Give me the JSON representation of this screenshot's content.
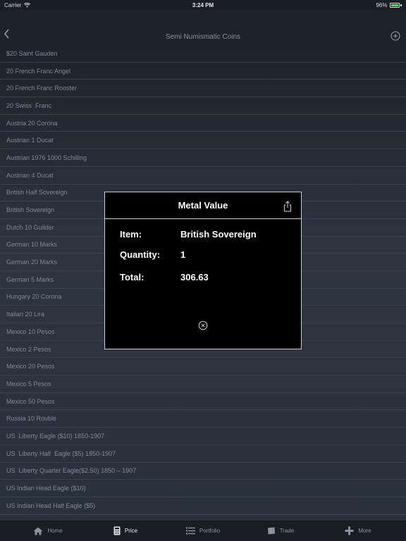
{
  "status": {
    "carrier": "Carrier",
    "time": "3:24 PM",
    "battery": "96%",
    "battery_level": 0.96
  },
  "nav": {
    "title": "Semi Numismatic Coins"
  },
  "list": [
    "$20 Saint Gauden",
    "20 French Franc Angel",
    "20 French Franc Rooster",
    "20 Swiss  Franc",
    "Austria 20 Corona",
    "Austrian 1 Ducat",
    "Austrian 1976 1000 Schilling",
    "Austrian 4 Ducat",
    "British Half Sovereign",
    "British Sovereign",
    "Dutch 10 Guilder",
    "German 10 Marks",
    "German 20 Marks",
    "German 5 Marks",
    "Hungary 20 Corona",
    "Italian 20 Lira",
    "Mexico 10 Pesos",
    "Mexico 2 Pesos",
    "Mexico 20 Pesos",
    "Mexico 5 Pesos",
    "Mexico 50 Pesos",
    "Russia 10 Rouble",
    "US  Liberty Eagle ($10) 1850-1907",
    "US  Liberty Half  Eagle ($5) 1850-1907",
    "US  Liberty Quarter Eagle($2.50) 1850 – 1907",
    "US Indian Head Eagle ($10)",
    "US Indian Head Half Eagle ($5)"
  ],
  "modal": {
    "title": "Metal Value",
    "item_label": "Item:",
    "item_value": "British Sovereign",
    "quantity_label": "Quantity:",
    "quantity_value": "1",
    "total_label": "Total:",
    "total_value": "306.63"
  },
  "tabs": [
    {
      "label": "Home",
      "icon": "home-icon"
    },
    {
      "label": "Price",
      "icon": "calculator-icon",
      "active": true
    },
    {
      "label": "Portfolio",
      "icon": "list-icon"
    },
    {
      "label": "Trade",
      "icon": "trade-icon"
    },
    {
      "label": "More",
      "icon": "plus-icon"
    }
  ]
}
